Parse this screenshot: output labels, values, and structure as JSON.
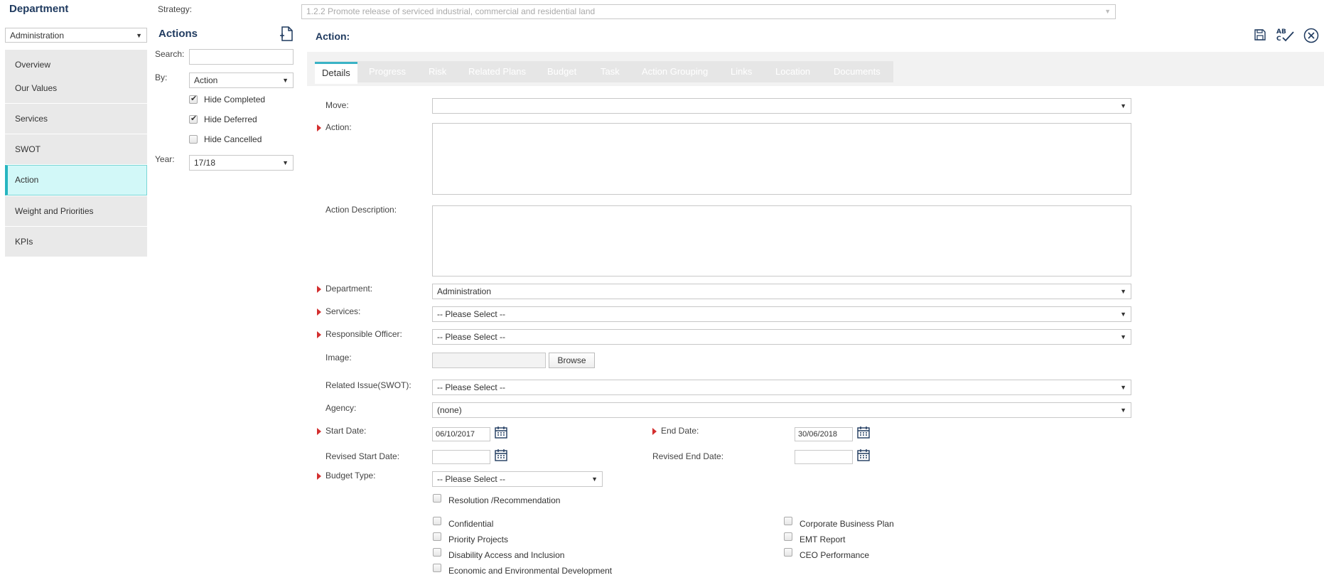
{
  "sidebar": {
    "title": "Department",
    "department_select": "Administration",
    "items": [
      {
        "label": "Overview"
      },
      {
        "label": "Our Values"
      },
      {
        "label": "Services"
      },
      {
        "label": "SWOT"
      },
      {
        "label": "Action"
      },
      {
        "label": "Weight and Priorities"
      },
      {
        "label": "KPIs"
      }
    ]
  },
  "filter": {
    "strategy_label": "Strategy:",
    "strategy_value": "1.2.2 Promote release of serviced industrial, commercial and residential land",
    "title": "Actions",
    "search_label": "Search:",
    "search_value": "",
    "by_label": "By:",
    "by_value": "Action",
    "hide_completed": "Hide Completed",
    "hide_deferred": "Hide Deferred",
    "hide_cancelled": "Hide Cancelled",
    "year_label": "Year:",
    "year_value": "17/18"
  },
  "main": {
    "title": "Action:",
    "tabs": [
      {
        "label": "Details"
      },
      {
        "label": "Progress"
      },
      {
        "label": "Risk"
      },
      {
        "label": "Related Plans"
      },
      {
        "label": "Budget"
      },
      {
        "label": "Task"
      },
      {
        "label": "Action Grouping"
      },
      {
        "label": "Links"
      },
      {
        "label": "Location"
      },
      {
        "label": "Documents"
      }
    ],
    "form": {
      "move_label": "Move:",
      "move_value": "",
      "action_label": "Action:",
      "action_value": "",
      "description_label": "Action Description:",
      "description_value": "",
      "department_label": "Department:",
      "department_value": "Administration",
      "services_label": "Services:",
      "services_value": "-- Please Select --",
      "officer_label": "Responsible Officer:",
      "officer_value": "-- Please Select --",
      "image_label": "Image:",
      "browse_label": "Browse",
      "swot_label": "Related Issue(SWOT):",
      "swot_value": "-- Please Select --",
      "agency_label": "Agency:",
      "agency_value": "(none)",
      "start_label": "Start Date:",
      "start_value": "06/10/2017",
      "end_label": "End Date:",
      "end_value": "30/06/2018",
      "rev_start_label": "Revised Start Date:",
      "rev_start_value": "",
      "rev_end_label": "Revised End Date:",
      "rev_end_value": "",
      "budget_label": "Budget Type:",
      "budget_value": "-- Please Select --",
      "resolution": "Resolution /Recommendation",
      "confidential": "Confidential",
      "priority": "Priority Projects",
      "disability": "Disability Access and Inclusion",
      "economic": "Economic and Environmental Development",
      "corporate": "Corporate Business Plan",
      "emt": "EMT Report",
      "ceo": "CEO Performance"
    }
  },
  "colors": {
    "accent": "#26b5c0",
    "active_bg": "#d2f8f8",
    "title": "#1f3a5f",
    "required": "#d32f2f"
  }
}
